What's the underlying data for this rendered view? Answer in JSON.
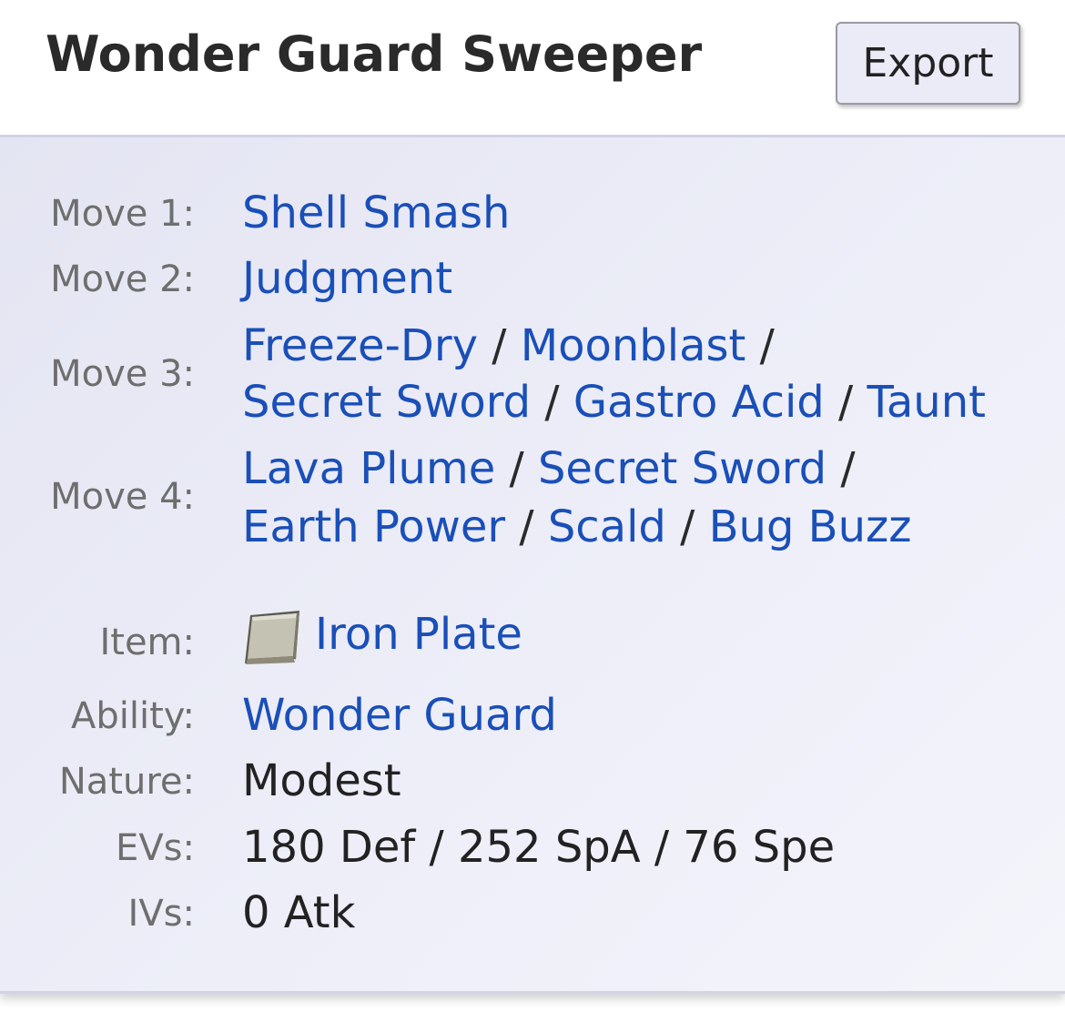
{
  "header": {
    "title": "Wonder Guard Sweeper",
    "export_label": "Export"
  },
  "moves": {
    "move1": {
      "label": "Move 1:",
      "options": [
        "Shell Smash"
      ]
    },
    "move2": {
      "label": "Move 2:",
      "options": [
        "Judgment"
      ]
    },
    "move3": {
      "label": "Move 3:",
      "options": [
        "Freeze-Dry",
        "Moonblast",
        "Secret Sword",
        "Gastro Acid",
        "Taunt"
      ]
    },
    "move4": {
      "label": "Move 4:",
      "options": [
        "Lava Plume",
        "Secret Sword",
        "Earth Power",
        "Scald",
        "Bug Buzz"
      ]
    },
    "separator": "/"
  },
  "details": {
    "item": {
      "label": "Item:",
      "value": "Iron Plate",
      "icon": "iron-plate-icon"
    },
    "ability": {
      "label": "Ability:",
      "value": "Wonder Guard"
    },
    "nature": {
      "label": "Nature:",
      "value": "Modest"
    },
    "evs": {
      "label": "EVs:",
      "value": "180 Def / 252 SpA / 76 Spe"
    },
    "ivs": {
      "label": "IVs:",
      "value": "0 Atk"
    }
  },
  "colors": {
    "link": "#1a4fb8",
    "label": "#6e6e6e",
    "text": "#222222",
    "body_bg": "#e9eaf5",
    "border": "#d2d2e6"
  }
}
